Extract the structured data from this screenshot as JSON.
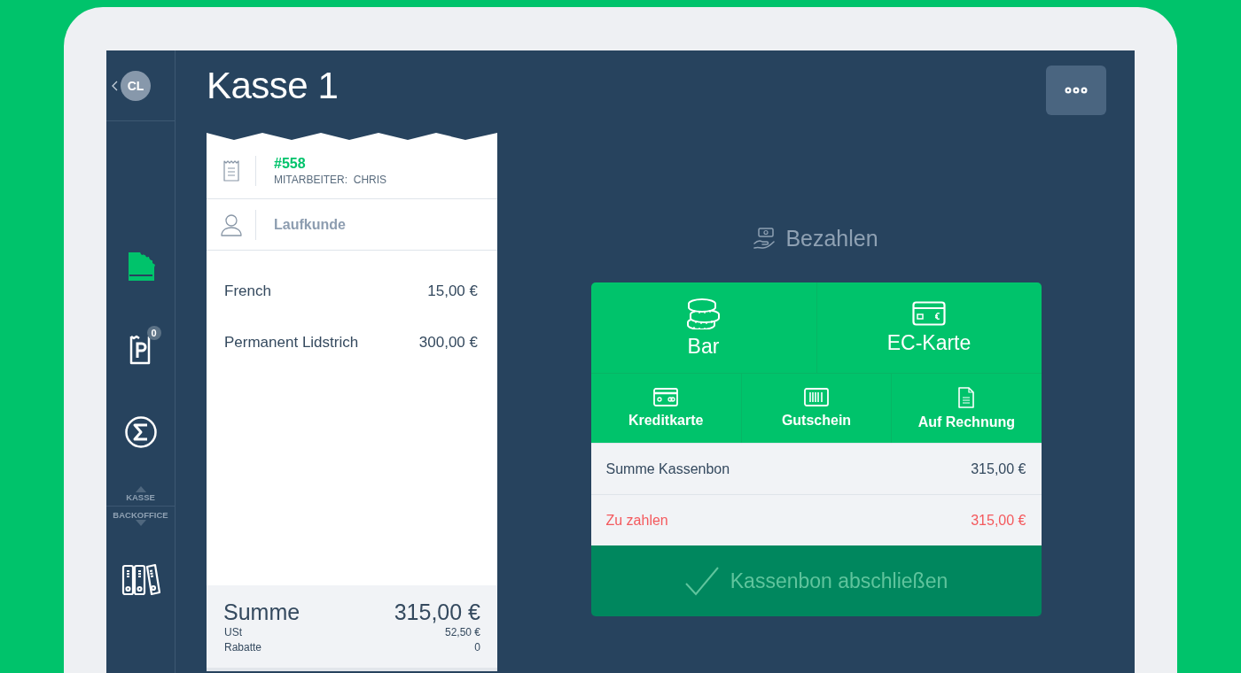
{
  "sidebar": {
    "avatar": "CL",
    "items": [
      {
        "kind": "receipt",
        "selected": true
      },
      {
        "kind": "parked",
        "selected": false,
        "badge": "0"
      },
      {
        "kind": "sum",
        "selected": false
      }
    ],
    "mode_switch": [
      "KASSE",
      "BACKOFFICE"
    ],
    "backoffice_items": [
      {
        "kind": "binders",
        "selected": false
      }
    ]
  },
  "header": {
    "title": "Kasse 1"
  },
  "receipt": {
    "number": "#558",
    "staff": "MITARBEITER:  CHRIS",
    "customer": "Laufkunde",
    "items": [
      {
        "name": "French",
        "price": "15,00 €"
      },
      {
        "name": "Permanent Lidstrich",
        "price": "300,00 €"
      }
    ],
    "total_label": "Summe",
    "total": "315,00 €",
    "details": [
      {
        "label": "USt",
        "value": "52,50 €"
      },
      {
        "label": "Rabatte",
        "value": "0"
      }
    ]
  },
  "payment": {
    "title": "Bezahlen",
    "primary_methods": [
      {
        "kind": "cash",
        "label": "Bar"
      },
      {
        "kind": "ec-card",
        "label": "EC-Karte"
      }
    ],
    "other_methods": [
      {
        "kind": "credit-card",
        "label": "Kreditkarte"
      },
      {
        "kind": "voucher",
        "label": "Gutschein"
      },
      {
        "kind": "invoice",
        "label": "Auf Rechnung"
      }
    ],
    "summary": [
      {
        "kind": "total",
        "label": "Summe Kassenbon",
        "value": "315,00 €"
      },
      {
        "kind": "due",
        "label": "Zu zahlen",
        "value": "315,00 €"
      }
    ],
    "finish_button": {
      "label": "Kassenbon abschließen",
      "disabled": true
    }
  }
}
